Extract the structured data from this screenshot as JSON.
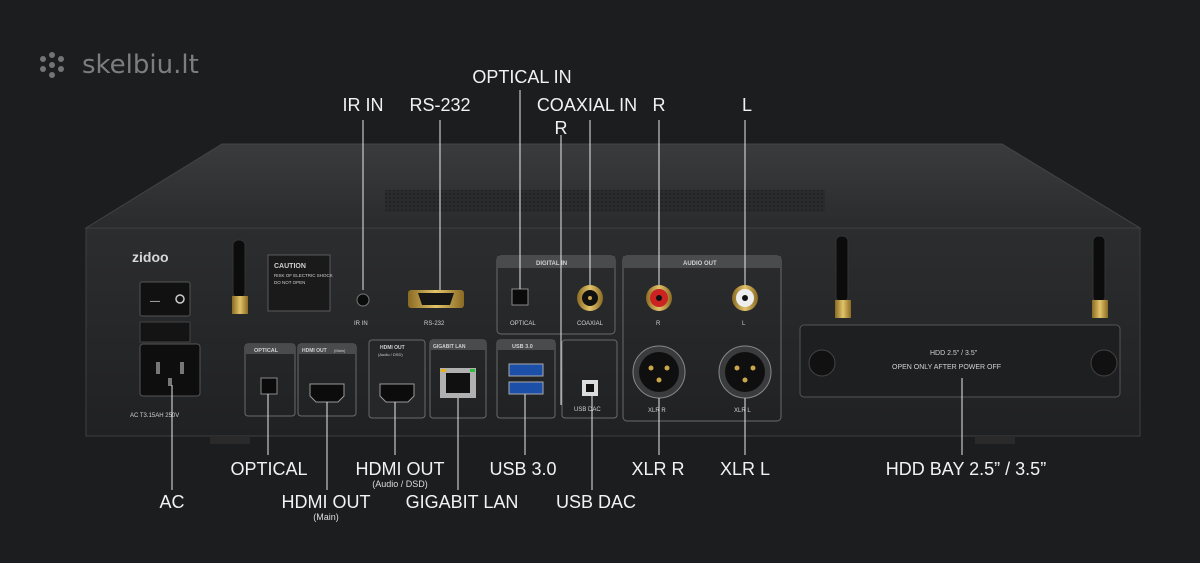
{
  "watermark": {
    "text": "skelbiu.lt"
  },
  "brand": {
    "logo_text": "zidoo"
  },
  "callouts": {
    "ir_in": "IR IN",
    "rs232": "RS-232",
    "optical_in": "OPTICAL IN",
    "coaxial_in": "COAXIAL IN",
    "r_top_small": "R",
    "r_top": "R",
    "l_top": "L",
    "optical": "OPTICAL",
    "ac": "AC",
    "hdmi_out_main": "HDMI OUT",
    "hdmi_out_main_sub": "(Main)",
    "hdmi_out_audio": "HDMI OUT",
    "hdmi_out_audio_sub": "(Audio / DSD)",
    "gigabit_lan": "GIGABIT LAN",
    "usb30": "USB 3.0",
    "usb_dac": "USB DAC",
    "xlr_r": "XLR R",
    "xlr_l": "XLR L",
    "hdd_bay": "HDD BAY 2.5”  / 3.5”"
  },
  "panel": {
    "caution_title": "CAUTION",
    "caution_line1": "RISK OF ELECTRIC SHOCK",
    "caution_line2": "DO NOT OPEN",
    "ir_in": "IR IN",
    "rs232": "RS-232",
    "digital_in": "DIGITAL IN",
    "optical": "OPTICAL",
    "coaxial": "COAXIAL",
    "audio_out": "AUDIO OUT",
    "r": "R",
    "l": "L",
    "xlr_r": "XLR R",
    "xlr_l": "XLR L",
    "optical_box": "OPTICAL",
    "hdmi_out_box": "HDMI OUT",
    "hdmi_out_box_main": "(Main)",
    "hdmi_out_audio_box": "HDMI OUT",
    "hdmi_out_audio_box_sub": "(Audio / DSD)",
    "gigabit_lan_box": "GIGABIT LAN",
    "usb30_box": "USB 3.0",
    "usb_dac": "USB DAC",
    "ac_rating": "AC    T3.15AH 250V",
    "hdd_line1": "HDD 2.5” / 3.5”",
    "hdd_line2": "OPEN ONLY AFTER POWER OFF"
  }
}
